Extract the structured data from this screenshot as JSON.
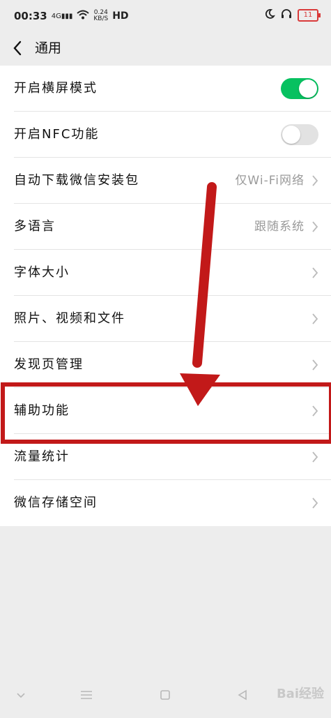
{
  "status_bar": {
    "time": "00:33",
    "signal": "4G",
    "speed_value": "0.24",
    "speed_unit": "KB/S",
    "network": "HD",
    "battery": "11"
  },
  "nav": {
    "title": "通用"
  },
  "settings": [
    {
      "label": "开启横屏模式",
      "control": "toggle",
      "on": true
    },
    {
      "label": "开启NFC功能",
      "control": "toggle",
      "on": false
    },
    {
      "label": "自动下载微信安装包",
      "value": "仅Wi-Fi网络"
    },
    {
      "label": "多语言",
      "value": "跟随系统"
    },
    {
      "label": "字体大小",
      "value": ""
    },
    {
      "label": "照片、视频和文件",
      "value": ""
    },
    {
      "label": "发现页管理",
      "value": ""
    },
    {
      "label": "辅助功能",
      "value": ""
    },
    {
      "label": "流量统计",
      "value": ""
    },
    {
      "label": "微信存储空间",
      "value": ""
    }
  ],
  "watermark": "Bai经验",
  "colors": {
    "toggle_on": "#07c160",
    "annotation": "#c21919"
  }
}
